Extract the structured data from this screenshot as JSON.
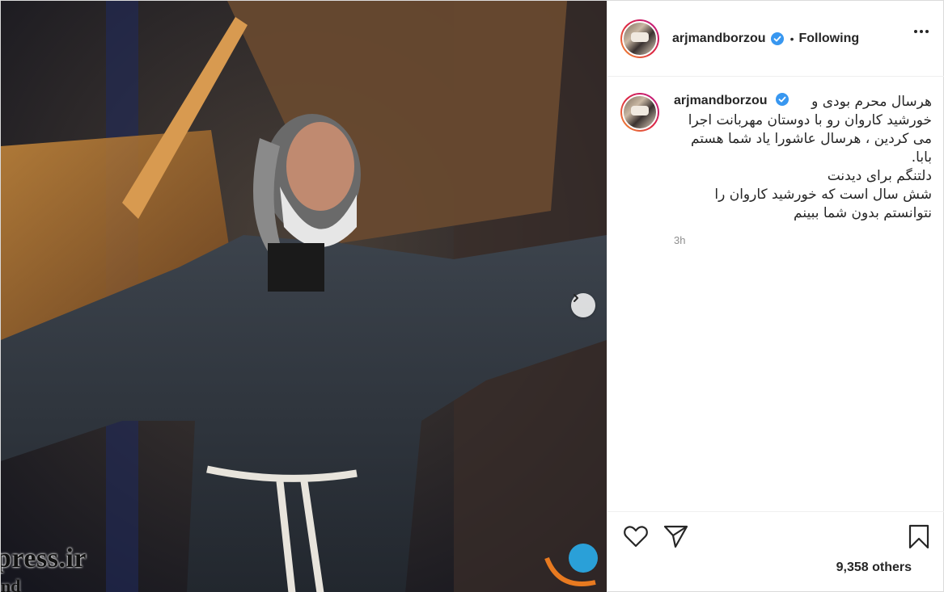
{
  "post": {
    "username": "arjmandborzou",
    "separator": "•",
    "follow_status": "Following",
    "caption": {
      "username": "arjmandborzou",
      "line1": "هرسال محرم بودی و",
      "lines": [
        "خورشید کاروان رو با دوستان مهربانت اجرا",
        "می کردین ، هرسال عاشورا یاد شما هستم",
        "بابا.",
        "دلتنگم برای دیدنت",
        "شش سال است که خورشید کاروان را",
        "نتوانستم بدون شما ببینم"
      ]
    },
    "timestamp": "3h",
    "likes_text": "9,358 others"
  },
  "media": {
    "watermark": "press.ir",
    "watermark2": "nd"
  },
  "icons": {
    "verified": "verified-badge-icon",
    "more": "more-options-icon",
    "next": "chevron-right-icon",
    "like": "heart-icon",
    "share": "paper-plane-icon",
    "save": "bookmark-icon"
  },
  "colors": {
    "verified": "#3897f0",
    "text": "#262626",
    "muted": "#8e8e8e",
    "border": "#dbdbdb"
  }
}
